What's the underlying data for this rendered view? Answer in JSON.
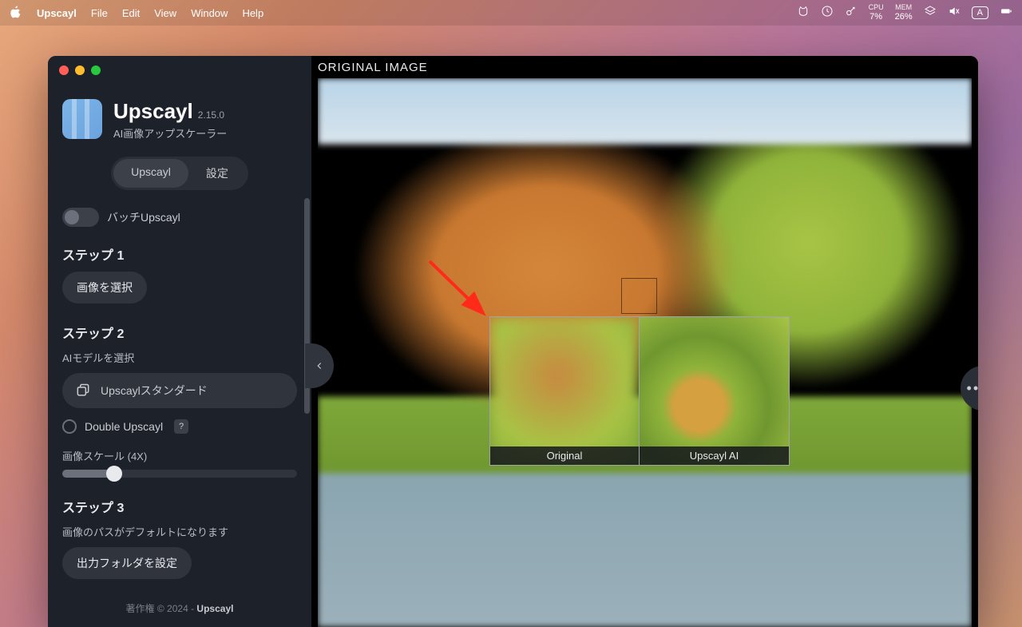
{
  "menubar": {
    "app": "Upscayl",
    "items": [
      "File",
      "Edit",
      "View",
      "Window",
      "Help"
    ],
    "cpu": {
      "label": "CPU",
      "value": "7%"
    },
    "mem": {
      "label": "MEM",
      "value": "26%"
    },
    "keymode": "A"
  },
  "brand": {
    "name": "Upscayl",
    "version": "2.15.0",
    "subtitle": "AI画像アップスケーラー"
  },
  "tabs": {
    "upscayl": "Upscayl",
    "settings": "設定"
  },
  "batch": {
    "label": "バッチUpscayl"
  },
  "step1": {
    "title": "ステップ 1",
    "button": "画像を選択"
  },
  "step2": {
    "title": "ステップ 2",
    "subtitle": "AIモデルを選択",
    "model": "Upscaylスタンダード",
    "double": "Double Upscayl",
    "help": "?",
    "scale_label": "画像スケール (4X)"
  },
  "step3": {
    "title": "ステップ 3",
    "subtitle": "画像のパスがデフォルトになります",
    "button": "出力フォルダを設定"
  },
  "footer": {
    "text": "著作権 © 2024 - ",
    "brand": "Upscayl"
  },
  "main": {
    "label": "ORIGINAL IMAGE",
    "compare": {
      "left": "Original",
      "right": "Upscayl AI"
    }
  }
}
